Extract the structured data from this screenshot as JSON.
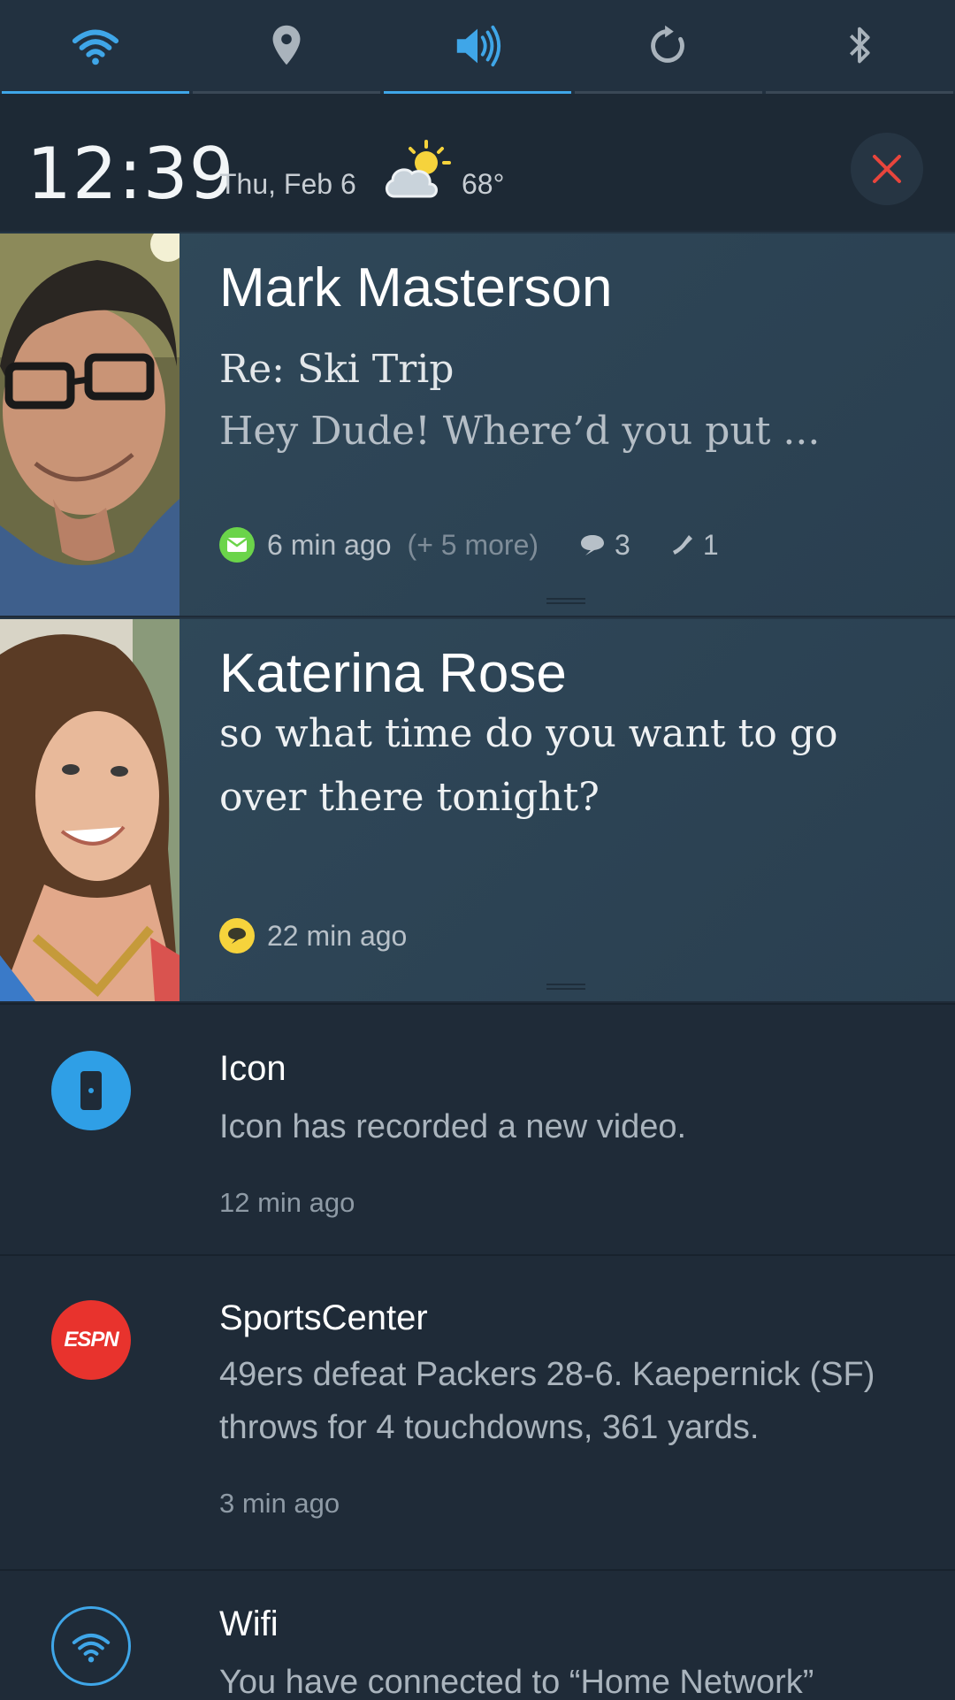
{
  "quick_settings": [
    {
      "icon": "wifi-icon",
      "active": true
    },
    {
      "icon": "location-icon",
      "active": false
    },
    {
      "icon": "volume-icon",
      "active": true
    },
    {
      "icon": "rotate-icon",
      "active": false
    },
    {
      "icon": "bluetooth-icon",
      "active": false
    }
  ],
  "header": {
    "time": "12:39",
    "date": "Thu, Feb 6",
    "weather_icon": "partly-cloudy-icon",
    "temperature": "68°"
  },
  "cards": [
    {
      "name": "Mark Masterson",
      "subject": "Re: Ski Trip",
      "preview": "Hey Dude! Where’d  you put ...",
      "badge_icon": "email-icon",
      "badge_color": "#6bd44a",
      "time": "6 min ago",
      "more": "(+ 5 more)",
      "comments": "3",
      "calls": "1"
    },
    {
      "name": "Katerina Rose",
      "message": "so what time do you want to go over there tonight?",
      "badge_icon": "chat-icon",
      "badge_color": "#f6d33c",
      "time": "22 min ago"
    }
  ],
  "notifications": [
    {
      "app": "Icon",
      "icon": "icon-app-icon",
      "icon_color": "#2f9fe6",
      "body": "Icon has recorded a new video.",
      "time": "12 min ago"
    },
    {
      "app": "SportsCenter",
      "icon": "espn-icon",
      "icon_label": "ESPN",
      "icon_color": "#e8332d",
      "body": "49ers defeat Packers 28-6. Kaepernick (SF) throws for 4 touchdowns, 361 yards.",
      "time": "3 min ago"
    },
    {
      "app": "Wifi",
      "icon": "wifi-notification-icon",
      "icon_color": "#3fa6e8",
      "body": "You have connected to “Home Network”"
    }
  ],
  "colors": {
    "accent": "#3fa6e8",
    "close": "#e8453c"
  }
}
